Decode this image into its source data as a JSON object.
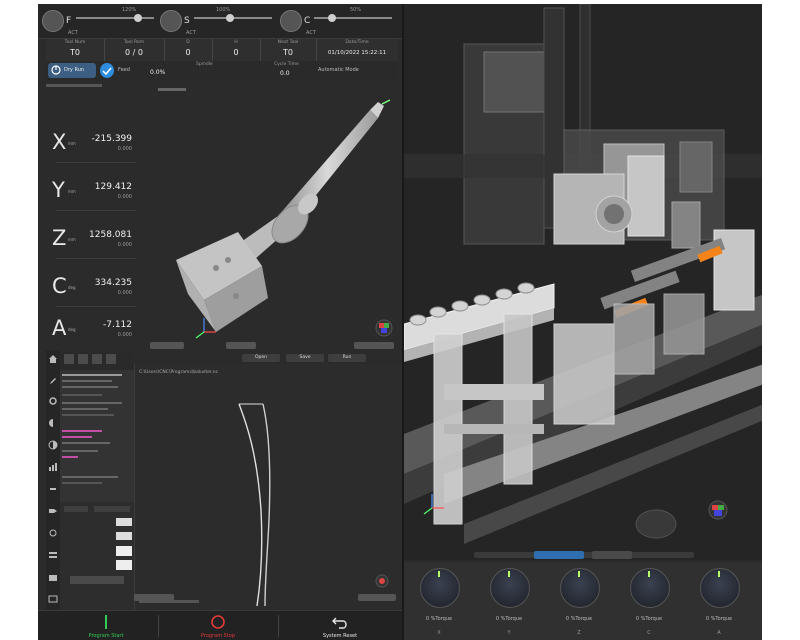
{
  "overrides": [
    {
      "letter": "F",
      "act_label": "ACT",
      "value": "120%"
    },
    {
      "letter": "S",
      "act_label": "ACT",
      "value": "100%"
    },
    {
      "letter": "C",
      "act_label": "ACT",
      "value": "50%"
    }
  ],
  "status_table": {
    "cells": [
      {
        "head": "Tool Num",
        "value": "T0"
      },
      {
        "head": "Tool Rem",
        "value": "0 / 0"
      },
      {
        "head": "D",
        "value": "0"
      },
      {
        "head": "H",
        "value": "0"
      },
      {
        "head": "Next Tool",
        "value": "T0"
      },
      {
        "head": "Date/Time",
        "value": "01/10/2022 15:22:11"
      }
    ]
  },
  "status_row2": {
    "mode_label": "Dry Run",
    "labels": [
      "Feed",
      "Spindle",
      "Cycle Time",
      "Automatic Mode"
    ],
    "feed": "0.0%",
    "speed": "0.0"
  },
  "axes": [
    {
      "letter": "X",
      "unit": "mm",
      "value": "-215.399",
      "sub": "0.000"
    },
    {
      "letter": "Y",
      "unit": "mm",
      "value": "129.412",
      "sub": "0.000"
    },
    {
      "letter": "Z",
      "unit": "mm",
      "value": "1258.081",
      "sub": "0.000"
    },
    {
      "letter": "C",
      "unit": "deg",
      "value": "334.235",
      "sub": "0.000"
    },
    {
      "letter": "A",
      "unit": "deg",
      "value": "-7.112",
      "sub": "0.000"
    }
  ],
  "editor": {
    "tabs": [
      "Open",
      "Save",
      "Run"
    ],
    "path": "C:\\Users\\CNC\\Programs\\baluster.nc"
  },
  "bottom_bar": {
    "start_label": "Program Start",
    "stop_label": "Program Stop",
    "reset_label": "System Reset"
  },
  "dials": [
    {
      "label": "0 %Torque",
      "axis": "X"
    },
    {
      "label": "0 %Torque",
      "axis": "Y"
    },
    {
      "label": "0 %Torque",
      "axis": "Z"
    },
    {
      "label": "0 %Torque",
      "axis": "C"
    },
    {
      "label": "0 %Torque",
      "axis": "A"
    }
  ],
  "colors": {
    "start": "#33cc55",
    "stop": "#e23b3b",
    "accent": "#2f8de0",
    "gauge": "#b8ff6a"
  }
}
